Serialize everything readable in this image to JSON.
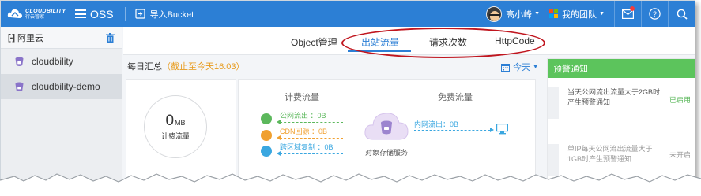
{
  "topbar": {
    "logo_en": "CLOUDBILITY",
    "logo_cn": "行云管家",
    "app_name": "OSS",
    "import_label": "导入Bucket",
    "user_name": "高小峰",
    "team_label": "我的团队",
    "icons": [
      "menu-icon",
      "import-icon",
      "team-icon",
      "mail-icon",
      "help-icon",
      "search-icon"
    ],
    "colors": {
      "bar": "#2c7fd5",
      "badge": "#f23c3c"
    }
  },
  "sidebar": {
    "provider": "阿里云",
    "provider_icon": "[-]",
    "items": [
      {
        "label": "cloudbility",
        "active": false
      },
      {
        "label": "cloudbility-demo",
        "active": true
      }
    ]
  },
  "tabs": [
    {
      "label": "Object管理",
      "active": false
    },
    {
      "label": "出站流量",
      "active": true
    },
    {
      "label": "请求次数",
      "active": false
    },
    {
      "label": "HttpCode",
      "active": false
    }
  ],
  "summary": {
    "title": "每日汇总",
    "time_note": "（截止至今天16:03）",
    "date_label": "今天",
    "total_value": "0",
    "total_unit": "MB",
    "total_label": "计费流量"
  },
  "flow": {
    "billed_title": "计费流量",
    "free_title": "免费流量",
    "billed_items": [
      {
        "label": "公网流出 ：0B",
        "color": "#5cb85c"
      },
      {
        "label": "CDN回源 ：0B",
        "color": "#f0a030"
      },
      {
        "label": "跨区域复制 ：0B",
        "color": "#3aa7e0"
      }
    ],
    "free_items": [
      {
        "label": "内网流出：0B",
        "color": "#3aa7e0"
      }
    ],
    "storage_label": "对象存储服务"
  },
  "notice": {
    "title": "预警通知",
    "items": [
      {
        "text": "当天公网流出流量大于2GB时产生预警通知",
        "status": "已启用",
        "status_color": "#5cb85c"
      },
      {
        "text": "单IP每天公网流出流量大于1GB时产生预警通知",
        "status": "未开启",
        "status_color": "#999999"
      }
    ]
  }
}
